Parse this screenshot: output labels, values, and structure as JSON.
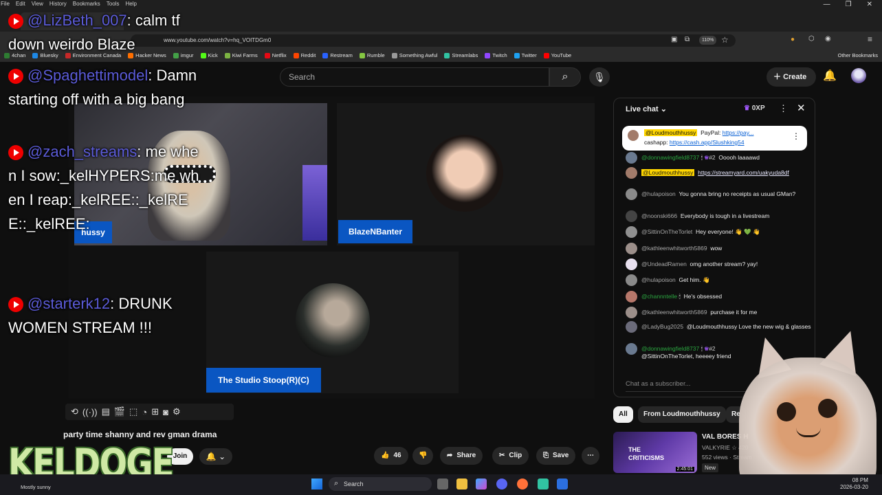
{
  "browser": {
    "menu": [
      "File",
      "Edit",
      "View",
      "History",
      "Bookmarks",
      "Tools",
      "Help"
    ],
    "url": "www.youtube.com/watch?v=hq_VOITDGm0",
    "zoom": "110%",
    "bookmarks": [
      "4chan",
      "Bluesky",
      "Environment Canada",
      "Hacker News",
      "imgur",
      "Kick",
      "Kiwi Farms",
      "Netflix",
      "Reddit",
      "Restream",
      "Rumble",
      "Something Awful",
      "Streamlabs",
      "Twitch",
      "Twitter",
      "YouTube"
    ],
    "bookmark_colors": [
      "#2e7d32",
      "#1e88e5",
      "#c62828",
      "#ff6f00",
      "#43a047",
      "#53fc18",
      "#7cb342",
      "#e50914",
      "#ff4500",
      "#2962ff",
      "#85c742",
      "#999999",
      "#31c3a2",
      "#9146ff",
      "#1da1f2",
      "#ff0000"
    ],
    "other_bookmarks": "Other Bookmarks"
  },
  "youtube": {
    "search_placeholder": "Search",
    "create_label": "Create",
    "video_title": "party time shanny and rev gman drama",
    "join_label": "Join",
    "likes": "46",
    "share_label": "Share",
    "clip_label": "Clip",
    "save_label": "Save"
  },
  "stream": {
    "host_label": "hussy",
    "blaze_label": "BlazeNBanter",
    "stoop_label": "The Studio Stoop(R)(C)",
    "logo_text": "KELDOGE"
  },
  "overlay_chat": [
    {
      "user": "@LizBeth_007",
      "text": "calm tf down weirdo Blaze"
    },
    {
      "user": "@Spaghettimodel",
      "text": "Damn starting off with a big bang"
    },
    {
      "user": "@zach_streams",
      "text": "me when I sow:_kelHYPERS:me when I reap:_kelREE::_kelREE::_kelREE:"
    },
    {
      "user": "@starterk12",
      "text": "DRUNK WOMEN STREAM !!!"
    }
  ],
  "live_chat": {
    "title": "Live chat",
    "xp": "0XP",
    "pinned": {
      "user": "@Loudmouthhussy",
      "paypal_label": "PayPal:",
      "paypal": "https://pay...",
      "cashapp_label": "cashapp:",
      "cashapp": "https://cash.app/Slushking54"
    },
    "messages": [
      {
        "user": "@donnawingfield8737",
        "badge": "#2",
        "text": "Ooooh laaaawd",
        "green": true
      },
      {
        "user": "@Loudmouthhussy",
        "text": "https://streamyard.com/uakyuda8df",
        "highlight": true
      },
      {
        "user": "@hulapoison",
        "text": "You gonna bring no receipts as usual GMan?"
      },
      {
        "user": "@noonski666",
        "text": "Everybody is tough in a livestream"
      },
      {
        "user": "@SittinOnTheTorlet",
        "text": "Hey everyone! 👋 💚 👋"
      },
      {
        "user": "@kathleenwhitworth5869",
        "text": "wow"
      },
      {
        "user": "@UndeadRamen",
        "text": "omg another stream? yay!"
      },
      {
        "user": "@hulapoison",
        "text": "Get him. 👋"
      },
      {
        "user": "@channntelle",
        "text": "He's obsessed",
        "green": true
      },
      {
        "user": "@kathleenwhitworth5869",
        "text": "purchase it for me"
      },
      {
        "user": "@LadyBug2025",
        "text": "@Loudmouthhussy Love the new wig & glasses"
      },
      {
        "user": "@donnawingfield8737",
        "badge": "#2",
        "text": "@SittinOnTheTorlet, heeeey friend",
        "green": true
      }
    ],
    "input_placeholder": "Chat as a subscriber...",
    "chips": [
      "All",
      "From Loudmouthhussy",
      "Re"
    ]
  },
  "suggestion": {
    "title": "VAL BORES H",
    "channel": "VALKYRIE ☆ 420",
    "views": "552 views · Stream",
    "badge": "New",
    "thumb_time": "2:45:01"
  },
  "taskbar": {
    "weather": "Mostly sunny",
    "search": "Search",
    "time": "08 PM",
    "date": "2026-03-20"
  }
}
